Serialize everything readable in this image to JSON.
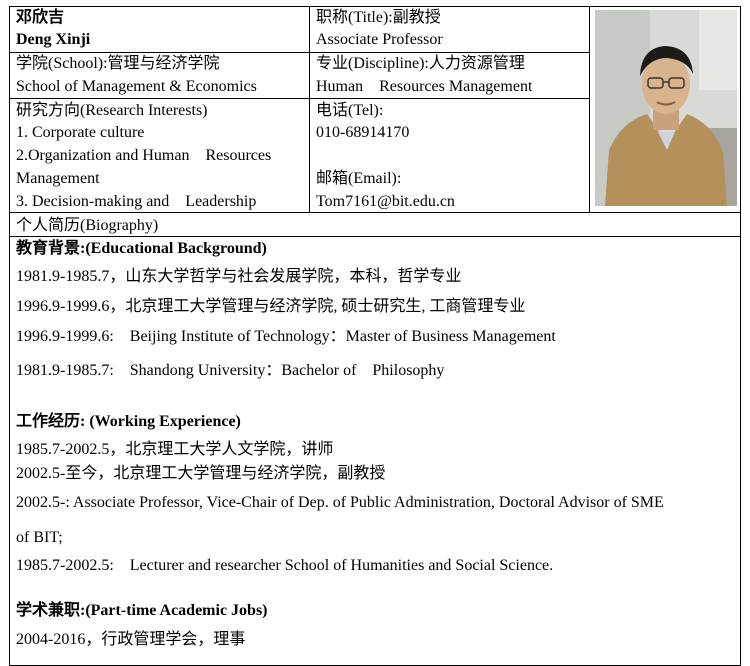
{
  "profile": {
    "name_cn": "邓欣吉",
    "name_en": "Deng Xinji",
    "title_label": "职称(Title):副教授",
    "title_en": "Associate Professor",
    "school_label": "学院(School):管理与经济学院",
    "school_en": "School of Management & Economics",
    "discipline_label": "专业(Discipline):人力资源管理",
    "discipline_en": "Human    Resources Management",
    "research_label": "研究方向(Research Interests)",
    "research_items": [
      "1. Corporate culture",
      "2.Organization and Human    Resources",
      "Management",
      "3. Decision-making and    Leadership"
    ],
    "tel_label": "电话(Tel):",
    "tel": "010-68914170",
    "email_label": "邮箱(Email):",
    "email": "Tom7161@bit.edu.cn"
  },
  "biography": {
    "label": "个人简历(Biography)",
    "education_heading": "教育背景:(Educational Background)",
    "education": [
      "1981.9-1985.7，山东大学哲学与社会发展学院，本科，哲学专业",
      "1996.9-1999.6，北京理工大学管理与经济学院, 硕士研究生, 工商管理专业",
      "1996.9-1999.6:    Beijing Institute of Technology：Master of Business Management",
      "1981.9-1985.7:    Shandong University：Bachelor of    Philosophy"
    ],
    "work_heading": "工作经历: (Working Experience)",
    "work": [
      "1985.7-2002.5，北京理工大学人文学院，讲师",
      "2002.5-至今，北京理工大学管理与经济学院，副教授",
      "2002.5-: Associate Professor, Vice-Chair of Dep. of Public Administration, Doctoral Advisor of SME",
      "of BIT;",
      "1985.7-2002.5:    Lecturer and researcher School of Humanities and Social Science."
    ],
    "parttime_heading": "学术兼职:(Part-time Academic Jobs)",
    "parttime": [
      "2004-2016，行政管理学会，理事"
    ]
  }
}
